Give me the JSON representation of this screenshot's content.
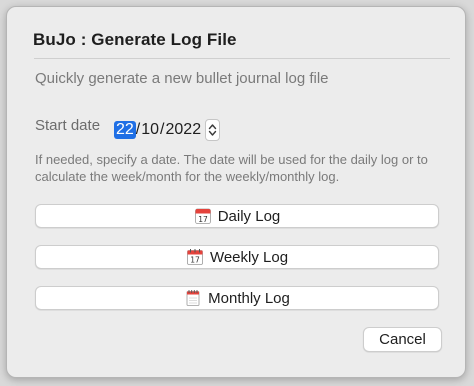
{
  "dialog": {
    "title": "BuJo : Generate Log File",
    "subtitle": "Quickly generate a new bullet journal log file"
  },
  "date": {
    "label": "Start date",
    "day": "22",
    "sep1": "/",
    "month": "10",
    "sep2": "/",
    "year": "2022",
    "hint": "If needed, specify a date. The date will be used for the daily log or to calculate the week/month for the weekly/monthly log."
  },
  "buttons": {
    "daily": {
      "label": "Daily Log",
      "icon": "calendar-tear-off-17-icon"
    },
    "weekly": {
      "label": "Weekly Log",
      "icon": "calendar-spiral-17-icon"
    },
    "monthly": {
      "label": "Monthly Log",
      "icon": "spiral-calendar-pad-icon"
    },
    "cancel": "Cancel"
  },
  "colors": {
    "accent": "#1f6fe5",
    "dialog_bg": "#ececec",
    "calendar_red": "#e5433c"
  }
}
